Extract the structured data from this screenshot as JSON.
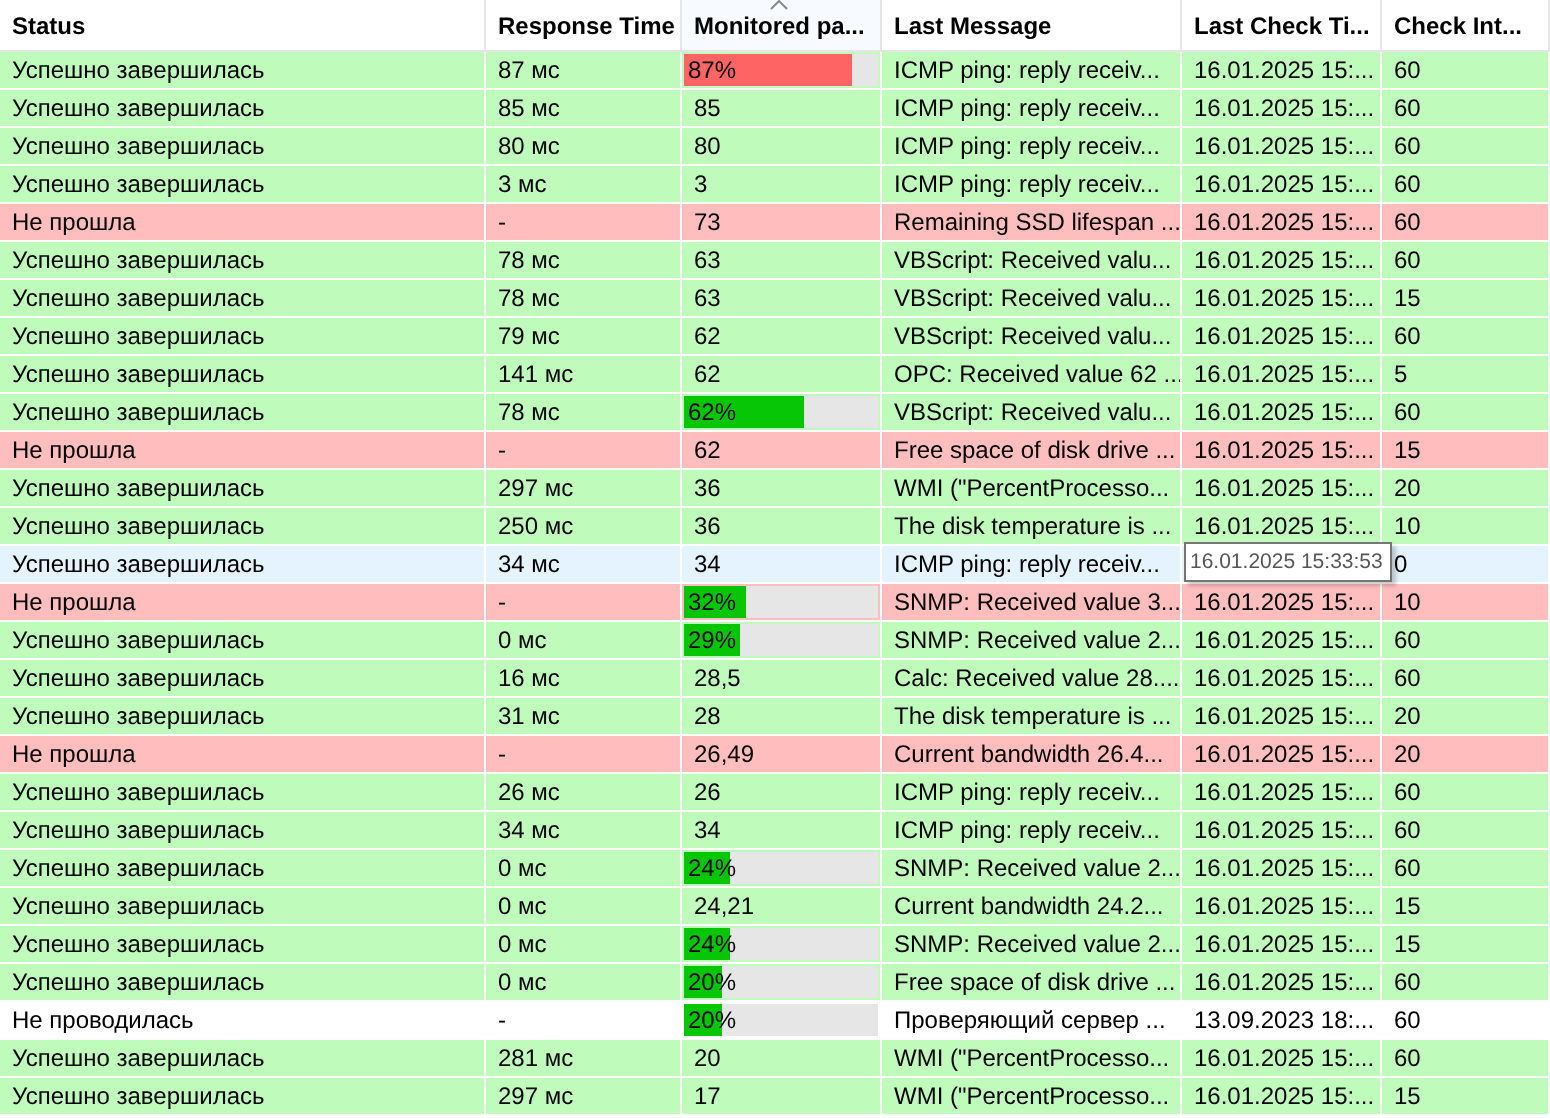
{
  "columns": [
    {
      "label": "Status",
      "sorted": false
    },
    {
      "label": "Response Time",
      "sorted": false
    },
    {
      "label": "Monitored pa...",
      "sorted": true
    },
    {
      "label": "Last Message",
      "sorted": false
    },
    {
      "label": "Last Check Ti...",
      "sorted": false
    },
    {
      "label": "Check Int...",
      "sorted": false
    }
  ],
  "rows": [
    {
      "kind": "ok",
      "hovered": false,
      "status": "Успешно завершилась",
      "response": "87 мс",
      "monitored": {
        "kind": "bar",
        "text": "87%",
        "level": 0.87,
        "color": "#ff6464"
      },
      "message": "ICMP ping: reply receiv...",
      "last_check": "16.01.2025 15:...",
      "interval": "60"
    },
    {
      "kind": "ok",
      "hovered": false,
      "status": "Успешно завершилась",
      "response": "85 мс",
      "monitored": {
        "kind": "text",
        "text": "85"
      },
      "message": "ICMP ping: reply receiv...",
      "last_check": "16.01.2025 15:...",
      "interval": "60"
    },
    {
      "kind": "ok",
      "hovered": false,
      "status": "Успешно завершилась",
      "response": "80 мс",
      "monitored": {
        "kind": "text",
        "text": "80"
      },
      "message": "ICMP ping: reply receiv...",
      "last_check": "16.01.2025 15:...",
      "interval": "60"
    },
    {
      "kind": "ok",
      "hovered": false,
      "status": "Успешно завершилась",
      "response": "3 мс",
      "monitored": {
        "kind": "text",
        "text": "3"
      },
      "message": "ICMP ping: reply receiv...",
      "last_check": "16.01.2025 15:...",
      "interval": "60"
    },
    {
      "kind": "fail",
      "hovered": false,
      "status": "Не прошла",
      "response": "-",
      "monitored": {
        "kind": "text",
        "text": "73"
      },
      "message": "Remaining SSD lifespan ...",
      "last_check": "16.01.2025 15:...",
      "interval": "60"
    },
    {
      "kind": "ok",
      "hovered": false,
      "status": "Успешно завершилась",
      "response": "78 мс",
      "monitored": {
        "kind": "text",
        "text": "63"
      },
      "message": "VBScript: Received valu...",
      "last_check": "16.01.2025 15:...",
      "interval": "60"
    },
    {
      "kind": "ok",
      "hovered": false,
      "status": "Успешно завершилась",
      "response": "78 мс",
      "monitored": {
        "kind": "text",
        "text": "63"
      },
      "message": "VBScript: Received valu...",
      "last_check": "16.01.2025 15:...",
      "interval": "15"
    },
    {
      "kind": "ok",
      "hovered": false,
      "status": "Успешно завершилась",
      "response": "79 мс",
      "monitored": {
        "kind": "text",
        "text": "62"
      },
      "message": "VBScript: Received valu...",
      "last_check": "16.01.2025 15:...",
      "interval": "60"
    },
    {
      "kind": "ok",
      "hovered": false,
      "status": "Успешно завершилась",
      "response": "141 мс",
      "monitored": {
        "kind": "text",
        "text": "62"
      },
      "message": "OPC: Received value 62 ...",
      "last_check": "16.01.2025 15:...",
      "interval": "5"
    },
    {
      "kind": "ok",
      "hovered": false,
      "status": "Успешно завершилась",
      "response": "78 мс",
      "monitored": {
        "kind": "bar",
        "text": "62%",
        "level": 0.62,
        "color": "#06c606"
      },
      "message": "VBScript: Received valu...",
      "last_check": "16.01.2025 15:...",
      "interval": "60"
    },
    {
      "kind": "fail",
      "hovered": false,
      "status": "Не прошла",
      "response": "-",
      "monitored": {
        "kind": "text",
        "text": "62"
      },
      "message": "Free space of disk drive ...",
      "last_check": "16.01.2025 15:...",
      "interval": "15"
    },
    {
      "kind": "ok",
      "hovered": false,
      "status": "Успешно завершилась",
      "response": "297 мс",
      "monitored": {
        "kind": "text",
        "text": "36"
      },
      "message": "WMI (\"PercentProcesso...",
      "last_check": "16.01.2025 15:...",
      "interval": "20"
    },
    {
      "kind": "ok",
      "hovered": false,
      "status": "Успешно завершилась",
      "response": "250 мс",
      "monitored": {
        "kind": "text",
        "text": "36"
      },
      "message": "The disk temperature is ...",
      "last_check": "16.01.2025 15:...",
      "interval": "10"
    },
    {
      "hovered": true,
      "status": "Успешно завершилась",
      "response": "34 мс",
      "monitored": {
        "kind": "text",
        "text": "34"
      },
      "message": "ICMP ping: reply receiv...",
      "tooltip": "16.01.2025 15:33:53",
      "interval": "0"
    },
    {
      "kind": "fail",
      "hovered": false,
      "status": "Не прошла",
      "response": "-",
      "monitored": {
        "kind": "bar",
        "text": "32%",
        "level": 0.32,
        "color": "#06c606"
      },
      "message": "SNMP: Received value 3...",
      "last_check": "16.01.2025 15:...",
      "interval": "10"
    },
    {
      "kind": "ok",
      "hovered": false,
      "status": "Успешно завершилась",
      "response": "0 мс",
      "monitored": {
        "kind": "bar",
        "text": "29%",
        "level": 0.29,
        "color": "#06c606"
      },
      "message": "SNMP: Received value 2...",
      "last_check": "16.01.2025 15:...",
      "interval": "60"
    },
    {
      "kind": "ok",
      "hovered": false,
      "status": "Успешно завершилась",
      "response": "16 мс",
      "monitored": {
        "kind": "text",
        "text": "28,5"
      },
      "message": "Calc: Received value 28....",
      "last_check": "16.01.2025 15:...",
      "interval": "60"
    },
    {
      "kind": "ok",
      "hovered": false,
      "status": "Успешно завершилась",
      "response": "31 мс",
      "monitored": {
        "kind": "text",
        "text": "28"
      },
      "message": "The disk temperature is ...",
      "last_check": "16.01.2025 15:...",
      "interval": "20"
    },
    {
      "kind": "fail",
      "hovered": false,
      "status": "Не прошла",
      "response": "-",
      "monitored": {
        "kind": "text",
        "text": "26,49"
      },
      "message": "Current bandwidth 26.4...",
      "last_check": "16.01.2025 15:...",
      "interval": "20"
    },
    {
      "kind": "ok",
      "hovered": false,
      "status": "Успешно завершилась",
      "response": "26 мс",
      "monitored": {
        "kind": "text",
        "text": "26"
      },
      "message": "ICMP ping: reply receiv...",
      "last_check": "16.01.2025 15:...",
      "interval": "60"
    },
    {
      "kind": "ok",
      "hovered": false,
      "status": "Успешно завершилась",
      "response": "34 мс",
      "monitored": {
        "kind": "text",
        "text": "34"
      },
      "message": "ICMP ping: reply receiv...",
      "last_check": "16.01.2025 15:...",
      "interval": "60"
    },
    {
      "kind": "ok",
      "hovered": false,
      "status": "Успешно завершилась",
      "response": "0 мс",
      "monitored": {
        "kind": "bar",
        "text": "24%",
        "level": 0.24,
        "color": "#06c606"
      },
      "message": "SNMP: Received value 2...",
      "last_check": "16.01.2025 15:...",
      "interval": "60"
    },
    {
      "kind": "ok",
      "hovered": false,
      "status": "Успешно завершилась",
      "response": "0 мс",
      "monitored": {
        "kind": "text",
        "text": "24,21"
      },
      "message": "Current bandwidth 24.2...",
      "last_check": "16.01.2025 15:...",
      "interval": "15"
    },
    {
      "kind": "ok",
      "hovered": false,
      "status": "Успешно завершилась",
      "response": "0 мс",
      "monitored": {
        "kind": "bar",
        "text": "24%",
        "level": 0.24,
        "color": "#06c606"
      },
      "message": "SNMP: Received value 2...",
      "last_check": "16.01.2025 15:...",
      "interval": "15"
    },
    {
      "kind": "ok",
      "hovered": false,
      "status": "Успешно завершилась",
      "response": "0 мс",
      "monitored": {
        "kind": "bar",
        "text": "20%",
        "level": 0.2,
        "color": "#06c606"
      },
      "message": "Free space of disk drive ...",
      "last_check": "16.01.2025 15:...",
      "interval": "60"
    },
    {
      "kind": "none",
      "hovered": false,
      "status": "Не проводилась",
      "response": "-",
      "monitored": {
        "kind": "bar",
        "text": "20%",
        "level": 0.2,
        "color": "#06c606"
      },
      "message": "Проверяющий сервер ...",
      "last_check": "13.09.2023 18:...",
      "interval": "60"
    },
    {
      "kind": "ok",
      "hovered": false,
      "status": "Успешно завершилась",
      "response": "281 мс",
      "monitored": {
        "kind": "text",
        "text": "20"
      },
      "message": "WMI (\"PercentProcesso...",
      "last_check": "16.01.2025 15:...",
      "interval": "60"
    },
    {
      "kind": "ok",
      "hovered": false,
      "status": "Успешно завершилась",
      "response": "297 мс",
      "monitored": {
        "kind": "text",
        "text": "17"
      },
      "message": "WMI (\"PercentProcesso...",
      "last_check": "16.01.2025 15:...",
      "interval": "15"
    }
  ]
}
